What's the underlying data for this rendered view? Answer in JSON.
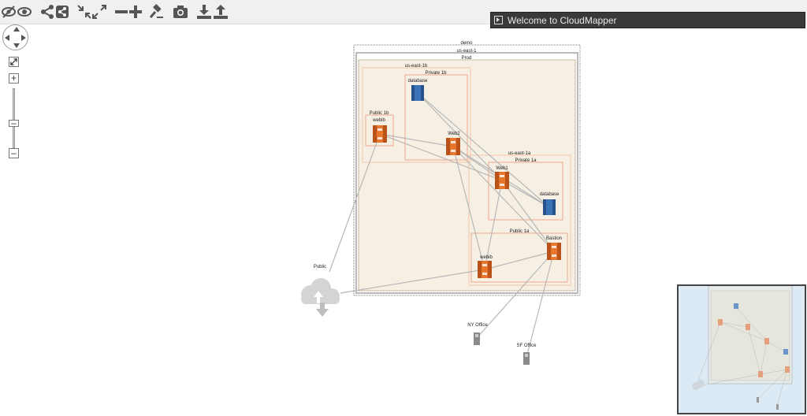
{
  "welcome_title": "Welcome to CloudMapper",
  "toolbar": {
    "icons": [
      "eye-slash-icon",
      "eye-icon",
      "share-icon",
      "share-square-icon",
      "compress-icon",
      "expand-icon",
      "minus-icon",
      "plus-icon",
      "gavel-icon",
      "camera-icon",
      "download-icon",
      "upload-icon"
    ]
  },
  "map": {
    "demo": "demo",
    "region": "us-east-1",
    "vpc": "Prod",
    "az_1b": "us-east-1b",
    "private_1b": "Private 1b",
    "public_1b": "Public 1b",
    "az_1a": "us-east-1a",
    "private_1a": "Private 1a",
    "public_1a": "Public 1a",
    "nodes": {
      "database_1b": "database",
      "webib_1b": "webib",
      "web2": "Web2",
      "web1": "Web1",
      "database_1a": "database",
      "bastion": "Bastion",
      "webib_1a": "webib",
      "public": "Public",
      "ny_office": "NY Office",
      "sf_office": "SF Office"
    }
  },
  "colors": {
    "ec2": "#e8772e",
    "rds": "#3b73b9",
    "zone_fill": "#f6efe4",
    "subnet_border": "#f3b4a0",
    "az_border": "#f4c7a8",
    "edge": "#b8b8b8"
  }
}
